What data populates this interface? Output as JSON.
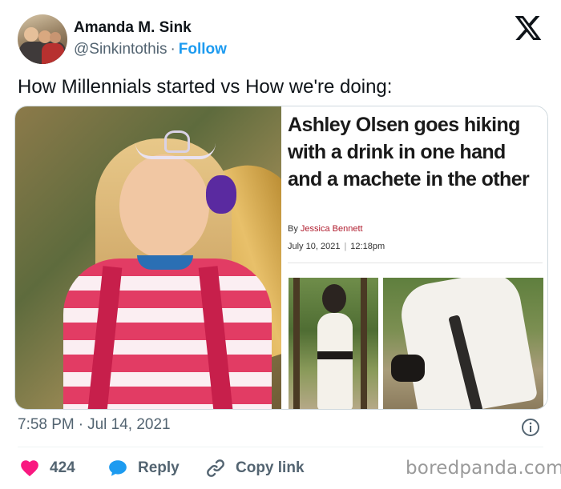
{
  "user": {
    "name": "Amanda M. Sink",
    "handle": "@Sinkintothis",
    "separator": "·",
    "follow_label": "Follow"
  },
  "tweet": {
    "text": "How Millennials started vs How we're doing:",
    "time": "7:58 PM",
    "separator": "·",
    "date": "Jul 14, 2021"
  },
  "article": {
    "headline": "Ashley Olsen goes hiking with a drink in one hand and a machete in the other",
    "by_label": "By",
    "author": "Jessica Bennett",
    "date": "July 10, 2021",
    "date_separator": "|",
    "time": "12:18pm"
  },
  "actions": {
    "like_count": "424",
    "reply_label": "Reply",
    "copy_label": "Copy link"
  },
  "watermark": "boredpanda.com",
  "colors": {
    "like": "#f91880",
    "reply": "#1d9bf0",
    "follow": "#1d9bf0",
    "byline_author": "#b01c2e"
  },
  "icons": [
    "x-logo-icon",
    "heart-icon",
    "reply-bubble-icon",
    "link-icon",
    "info-icon"
  ]
}
